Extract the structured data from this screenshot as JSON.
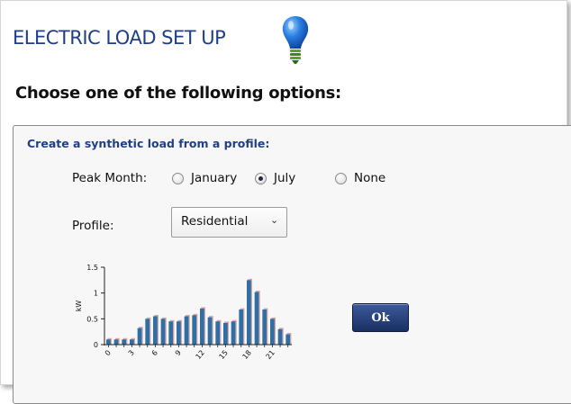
{
  "header": {
    "title": "ELECTRIC LOAD SET UP",
    "icon": "lightbulb-icon",
    "subtitle": "Choose one of the following options:"
  },
  "synthetic_load": {
    "title": "Create a synthetic load from a profile:",
    "peak_month_label": "Peak Month:",
    "peak_month_options": [
      "January",
      "July",
      "None"
    ],
    "peak_month_selected": "July",
    "profile_label": "Profile:",
    "profile_value": "Residential",
    "ok_label": "Ok"
  },
  "colors": {
    "title": "#1f3f86",
    "bar": "#2f6fa3",
    "bar_shadow": "#d9a7a7",
    "button": "#2a4480"
  },
  "chart_data": {
    "type": "bar",
    "ylabel": "kW",
    "ylim": [
      0,
      1.5
    ],
    "yticks": [
      0,
      0.5,
      1,
      1.5
    ],
    "ytick_labels": [
      "0",
      "0.5",
      "1",
      "1.5"
    ],
    "xtick_labels": [
      "0",
      "3",
      "6",
      "9",
      "12",
      "15",
      "18",
      "21"
    ],
    "categories": [
      0,
      1,
      2,
      3,
      4,
      5,
      6,
      7,
      8,
      9,
      10,
      11,
      12,
      13,
      14,
      15,
      16,
      17,
      18,
      19,
      20,
      21,
      22,
      23
    ],
    "values": [
      0.1,
      0.1,
      0.1,
      0.1,
      0.32,
      0.5,
      0.55,
      0.5,
      0.45,
      0.45,
      0.55,
      0.57,
      0.7,
      0.53,
      0.45,
      0.42,
      0.45,
      0.68,
      1.25,
      1.02,
      0.68,
      0.5,
      0.3,
      0.2
    ],
    "grid": false
  }
}
